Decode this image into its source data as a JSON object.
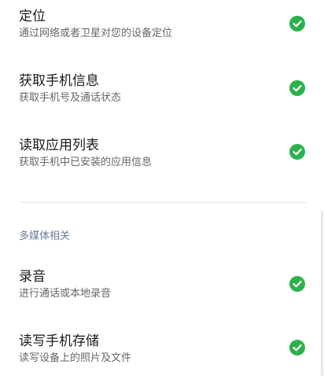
{
  "permissions_top": [
    {
      "title": "定位",
      "desc": "通过网络或者卫星对您的设备定位",
      "enabled_icon": "check-circle-icon"
    },
    {
      "title": "获取手机信息",
      "desc": "获取手机号及通话状态",
      "enabled_icon": "check-circle-icon"
    },
    {
      "title": "读取应用列表",
      "desc": "获取手机中已安装的应用信息",
      "enabled_icon": "check-circle-icon"
    }
  ],
  "multimedia_section": {
    "header": "多媒体相关",
    "items": [
      {
        "title": "录音",
        "desc": "进行通话或本地录音",
        "enabled_icon": "check-circle-icon"
      },
      {
        "title": "读写手机存储",
        "desc": "读写设备上的照片及文件",
        "enabled_icon": "check-circle-icon"
      }
    ]
  },
  "colors": {
    "check_green": "#2bb24c",
    "title_text": "#1a1a1a",
    "desc_text": "#666666",
    "section_header_text": "#6b7a99",
    "divider": "#e5e5e5"
  }
}
